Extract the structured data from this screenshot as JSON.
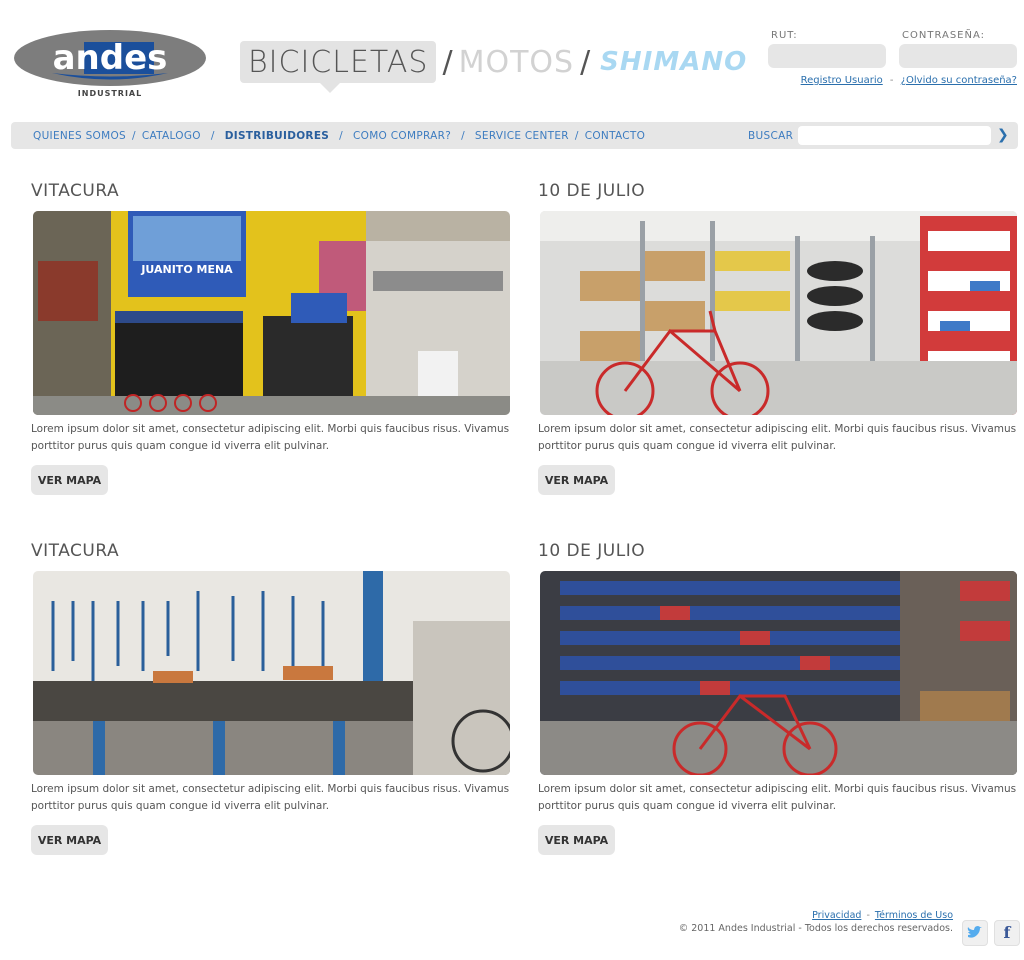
{
  "logo": {
    "name": "andes",
    "sub": "INDUSTRIAL"
  },
  "brands": {
    "active": "BICICLETAS",
    "motos": "MOTOS",
    "shimano": "SHIMANO",
    "slash": "/"
  },
  "login": {
    "rut_label": "RUT:",
    "password_label": "CONTRASEÑA:",
    "register_link": "Registro Usuario",
    "separator": "-",
    "forgot_link": "¿Olvido su contraseña?"
  },
  "nav": {
    "items": [
      "QUIENES SOMOS",
      "CATALOGO",
      "DISTRIBUIDORES",
      "COMO COMPRAR?",
      "SERVICE CENTER",
      "CONTACTO"
    ],
    "active": "DISTRIBUIDORES",
    "search_label": "BUSCAR",
    "search_placeholder": ""
  },
  "stores": [
    {
      "title": "VITACURA",
      "desc": "Lorem ipsum dolor sit amet, consectetur adipiscing elit. Morbi quis faucibus risus. Vivamus porttitor purus quis quam congue id viverra elit pulvinar.",
      "button": "VER MAPA",
      "sign": "JUANITO MENA"
    },
    {
      "title": "10 DE JULIO",
      "desc": "Lorem ipsum dolor sit amet, consectetur adipiscing elit. Morbi quis faucibus risus. Vivamus porttitor purus quis quam congue id viverra elit pulvinar.",
      "button": "VER MAPA"
    },
    {
      "title": "VITACURA",
      "desc": "Lorem ipsum dolor sit amet, consectetur adipiscing elit. Morbi quis faucibus risus. Vivamus porttitor purus quis quam congue id viverra elit pulvinar.",
      "button": "VER MAPA"
    },
    {
      "title": "10 DE JULIO",
      "desc": "Lorem ipsum dolor sit amet, consectetur adipiscing elit. Morbi quis faucibus risus. Vivamus porttitor purus quis quam congue id viverra elit pulvinar.",
      "button": "VER MAPA"
    }
  ],
  "footer": {
    "privacy": "Privacidad",
    "sep": "-",
    "terms": "Términos de Uso",
    "copyright": "© 2011 Andes Industrial  -  Todos los derechos reservados."
  },
  "social": {
    "twitter": "twitter-icon",
    "facebook": "facebook-icon"
  },
  "colors": {
    "link": "#2a6fad",
    "nav": "#3d7cc0",
    "shimano": "#a9d8f2",
    "panel": "#e6e6e6"
  }
}
